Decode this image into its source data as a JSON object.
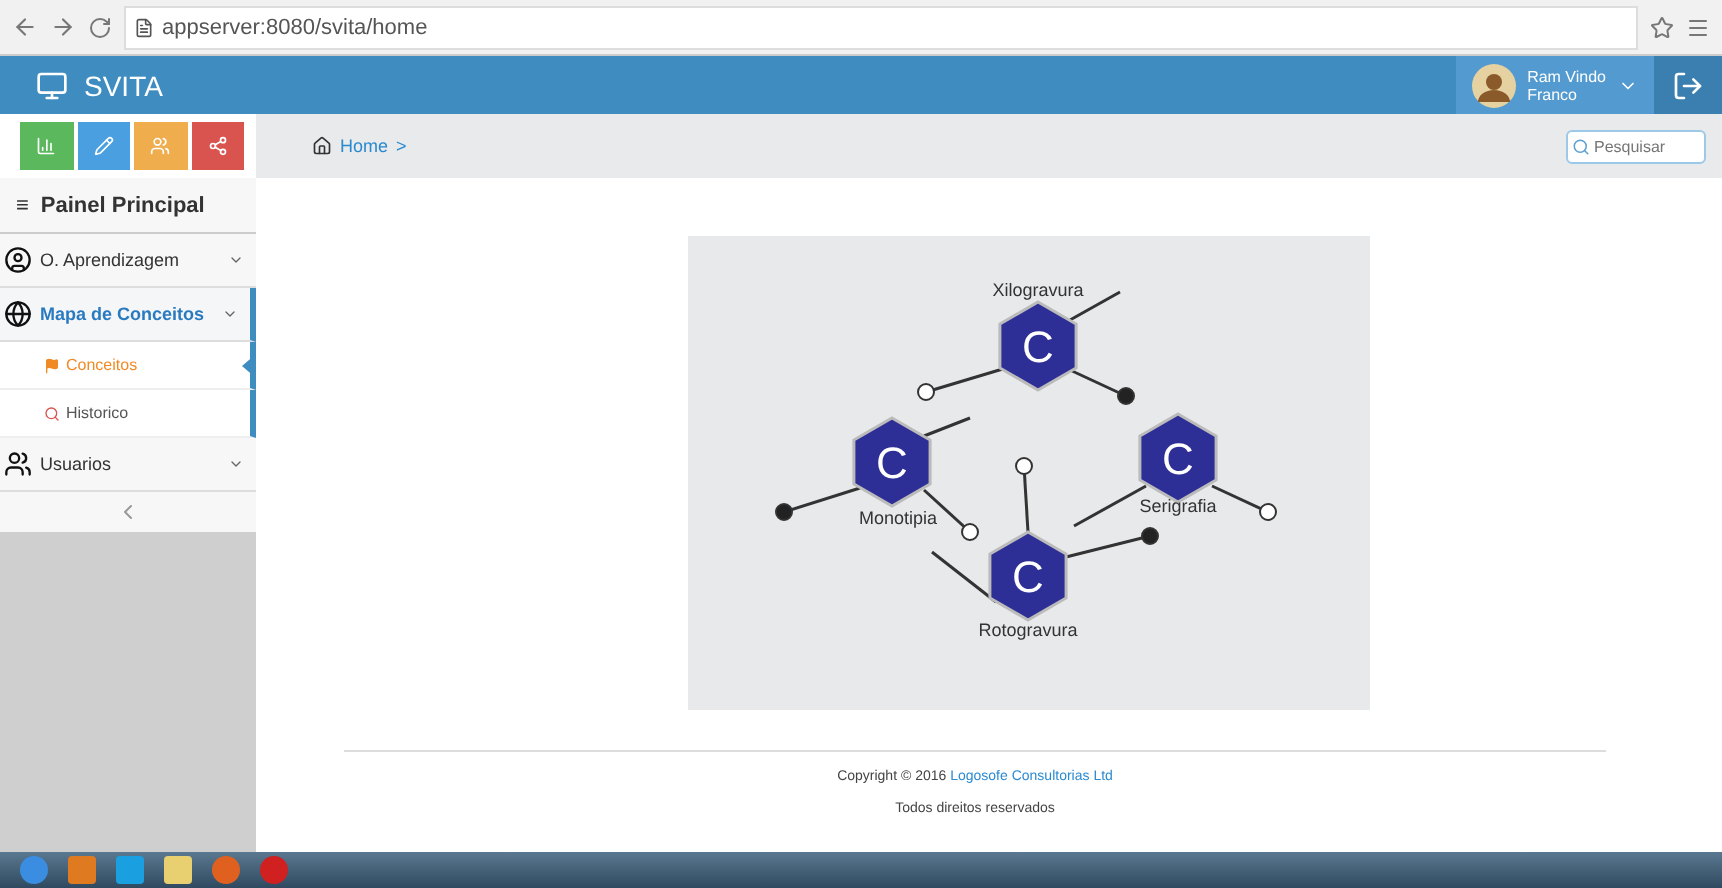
{
  "browser": {
    "url": "appserver:8080/svita/home"
  },
  "header": {
    "brand": "SVITA",
    "user": {
      "first_line": "Ram Vindo",
      "second_line": "Franco"
    }
  },
  "breadcrumb": {
    "items": [
      "Home",
      ">"
    ]
  },
  "search": {
    "placeholder": "Pesquisar"
  },
  "sidebar": {
    "glyph": "≡",
    "title": "Painel Principal",
    "items": [
      {
        "label": "O. Aprendizagem",
        "selected": false
      },
      {
        "label": "Mapa de Conceitos",
        "selected": true,
        "children": [
          {
            "label": "Conceitos",
            "selected": true
          },
          {
            "label": "Historico",
            "selected": false
          }
        ]
      },
      {
        "label": "Usuarios",
        "selected": false
      }
    ]
  },
  "concept_map": {
    "nodes": [
      {
        "symbol": "C",
        "label": "Xilogravura"
      },
      {
        "symbol": "C",
        "label": "Monotipia"
      },
      {
        "symbol": "C",
        "label": "Serigrafia"
      },
      {
        "symbol": "C",
        "label": "Rotogravura"
      }
    ]
  },
  "footer": {
    "copyright": "Copyright © 2016",
    "company": "Logosofe Consultorias Ltd",
    "rights": "Todos direitos reservados"
  }
}
